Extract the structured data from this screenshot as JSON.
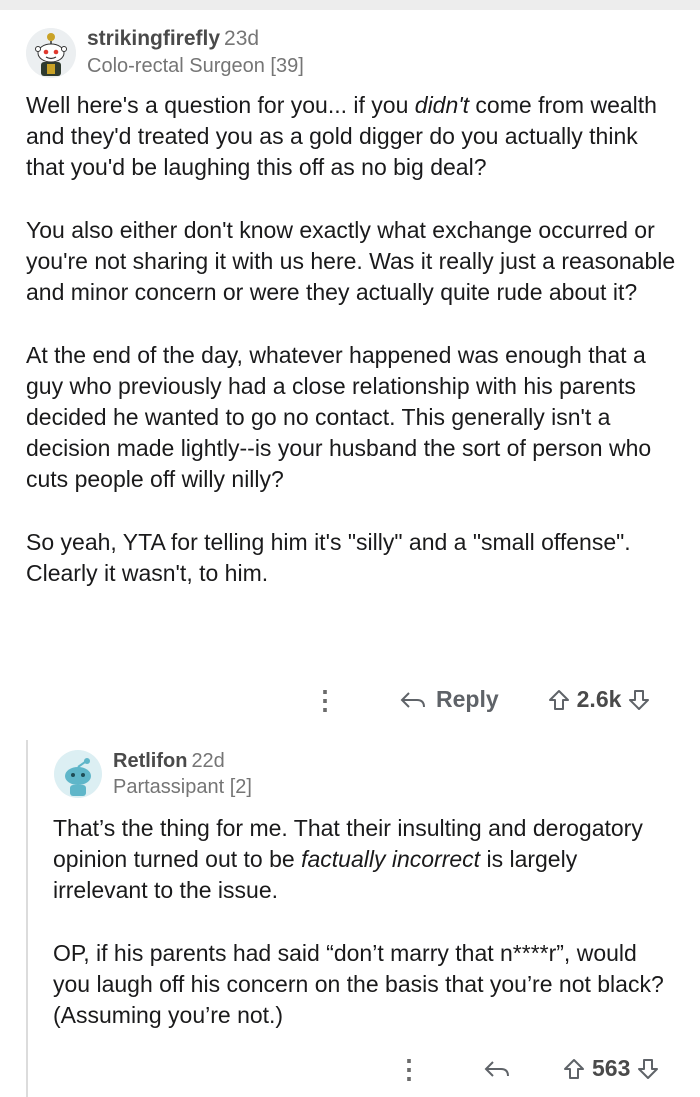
{
  "comment1": {
    "username": "strikingfirefly",
    "age": "23d",
    "flair": "Colo-rectal Surgeon [39]",
    "paragraphs": [
      {
        "pre": "Well here's a question for you... if you ",
        "em": "didn't",
        "post": " come from wealth and they'd treated you as a gold digger do you actually think that you'd be laughing this off as no big deal?"
      },
      {
        "pre": "You also either don't know exactly what exchange occurred or you're not sharing it with us here. Was it really just a reasonable and minor concern or were they actually quite rude about it?",
        "em": "",
        "post": ""
      },
      {
        "pre": "At the end of the day, whatever happened was enough that a guy who previously had a close relationship with his parents decided he wanted to go no contact. This generally isn't a decision made lightly--is your husband the sort of person who cuts people off willy nilly?",
        "em": "",
        "post": ""
      },
      {
        "pre": "So yeah, YTA for telling him it's \"silly\" and a \"small offense\". Clearly it wasn't, to him.",
        "em": "",
        "post": ""
      }
    ],
    "actions": {
      "more": "⋮",
      "reply_label": "Reply",
      "votes": "2.6k"
    }
  },
  "comment2": {
    "username": "Retlifon",
    "age": "22d",
    "flair": "Partassipant [2]",
    "paragraphs": [
      {
        "pre": "That’s the thing for me. That their insulting and derogatory opinion turned out to be ",
        "em": "factually incorrect",
        "post": " is largely irrelevant to the issue."
      },
      {
        "pre": "OP, if his parents had said “don’t marry that n****r”, would you laugh off his concern on the basis that you’re not black? (Assuming you’re not.)",
        "em": "",
        "post": ""
      }
    ],
    "actions": {
      "more": "⋮",
      "votes": "563"
    }
  },
  "icons": [
    "more-options-icon",
    "reply-icon",
    "upvote-icon",
    "downvote-icon",
    "avatar-icon"
  ],
  "colors": {
    "text": "#1a1a1b",
    "meta": "#757575",
    "icon": "#5f6368",
    "thread_line": "#dcdcdc"
  }
}
